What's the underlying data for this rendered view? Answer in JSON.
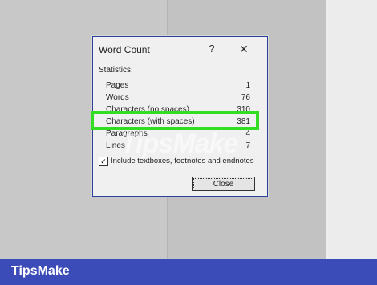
{
  "dialog": {
    "title": "Word Count",
    "help_glyph": "?",
    "close_glyph": "✕",
    "section_label": "Statistics:",
    "rows": [
      {
        "label": "Pages",
        "value": "1"
      },
      {
        "label": "Words",
        "value": "76"
      },
      {
        "label": "Characters (no spaces)",
        "value": "310"
      },
      {
        "label": "Characters (with spaces)",
        "value": "381"
      },
      {
        "label": "Paragraphs",
        "value": "4"
      },
      {
        "label": "Lines",
        "value": "7"
      }
    ],
    "checkbox_label": "Include textboxes, footnotes and endnotes",
    "checkbox_checked": true,
    "checkbox_glyph": "✓",
    "close_button_label": "Close"
  },
  "watermark": {
    "text": "TipsMake",
    "sub": ".com"
  },
  "footer": {
    "brand": "TipsMake"
  },
  "colors": {
    "highlight": "#33dd22",
    "footer": "#3b4bb8",
    "dialog_border": "#2f3f9c"
  }
}
